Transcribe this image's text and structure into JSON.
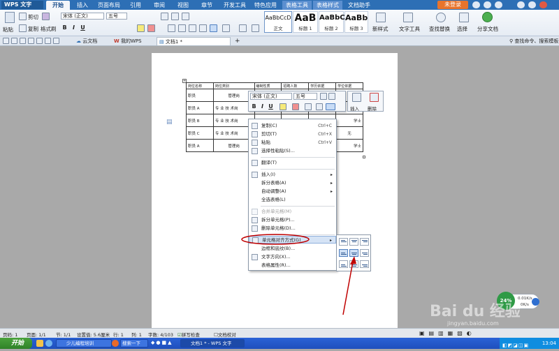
{
  "app": {
    "logo": "WPS 文字",
    "login": "未登录"
  },
  "menu_tabs": [
    "开始",
    "插入",
    "页面布局",
    "引用",
    "审阅",
    "视图",
    "章节",
    "开发工具",
    "特色应用",
    "表格工具",
    "表格样式",
    "文档助手"
  ],
  "ribbon": {
    "paste": "粘贴",
    "cut": "剪切",
    "copy": "复制",
    "format_painter": "格式刷",
    "font_name": "宋体 (正文)",
    "font_size": "五号",
    "bold": "B",
    "italic": "I",
    "underline": "U",
    "styles": [
      {
        "sample": "AaBbCcD",
        "label": "正文"
      },
      {
        "sample": "AaB",
        "label": "标题 1"
      },
      {
        "sample": "AaBbC",
        "label": "标题 2"
      },
      {
        "sample": "AaBb",
        "label": "标题 3"
      }
    ],
    "new_style": "新样式",
    "text_tools": "文字工具",
    "find_replace": "查找替换",
    "select": "选择",
    "share": "分享文档"
  },
  "doc_tabs": {
    "cloud": "云文档",
    "mywps": "我的WPS",
    "doc1": "文档1 *",
    "search_hint": "查找命令、搜索模板"
  },
  "table": {
    "headers": [
      "岗位名称",
      "岗位类别",
      "编制性质",
      "招聘人数",
      "学历依据",
      "学位依据"
    ],
    "rows": [
      [
        "职员",
        "管理岗",
        "",
        "",
        "",
        ""
      ],
      [
        "职员 A",
        "专 业 技 术岗",
        "",
        "",
        "本科",
        "学士"
      ],
      [
        "职员 B",
        "专 业 技 术岗",
        "",
        "",
        "本科",
        "学士"
      ],
      [
        "职员 C",
        "专 业 技 术岗",
        "",
        "",
        "",
        "无"
      ],
      [
        "职员 A",
        "管理岗",
        "",
        "",
        "",
        "学士"
      ]
    ]
  },
  "mini_toolbar": {
    "font": "宋体 (正文)",
    "size": "五号",
    "insert": "插入",
    "delete": "删除"
  },
  "context_menu": [
    {
      "label": "复制(C)",
      "shortcut": "Ctrl+C"
    },
    {
      "label": "剪切(T)",
      "shortcut": "Ctrl+X"
    },
    {
      "label": "粘贴",
      "shortcut": "Ctrl+V"
    },
    {
      "label": "选择性粘贴(S)..."
    },
    {
      "label": "翻译(T)"
    },
    {
      "label": "插入(I)",
      "sub": true
    },
    {
      "label": "拆分表格(A)",
      "sub": true
    },
    {
      "label": "自动调整(A)",
      "sub": true
    },
    {
      "label": "全选表格(L)"
    },
    {
      "label": "合并单元格(M)",
      "disabled": true
    },
    {
      "label": "拆分单元格(P)..."
    },
    {
      "label": "删除单元格(D)..."
    },
    {
      "label": "单元格对齐方式(G)",
      "sub": true,
      "highlight": true
    },
    {
      "label": "边框和底纹(B)..."
    },
    {
      "label": "文字方向(X)..."
    },
    {
      "label": "表格属性(R)..."
    }
  ],
  "status": {
    "page_code": "页码: 1",
    "page": "页面: 1/1",
    "section": "节: 1/1",
    "setting": "设置值: 5.6厘米",
    "row": "行: 1",
    "col": "列: 1",
    "words": "字数: 4/103",
    "spell": "拼写检查",
    "proof": "文档校对"
  },
  "widget": {
    "percent": "24%",
    "down": "0.01K/s",
    "up": "0K/s"
  },
  "watermark": {
    "brand": "Bai du 经验",
    "url": "jingyan.baidu.com"
  },
  "taskbar": {
    "start": "开始",
    "task1": "少儿编程培训",
    "search": "搜索一下",
    "task2": "文档1 * - WPS 文字",
    "clock": "13:04"
  },
  "colors": {
    "accent": "#2d6fb5",
    "highlight": "#d5e3f5",
    "annotation": "#c00000"
  }
}
